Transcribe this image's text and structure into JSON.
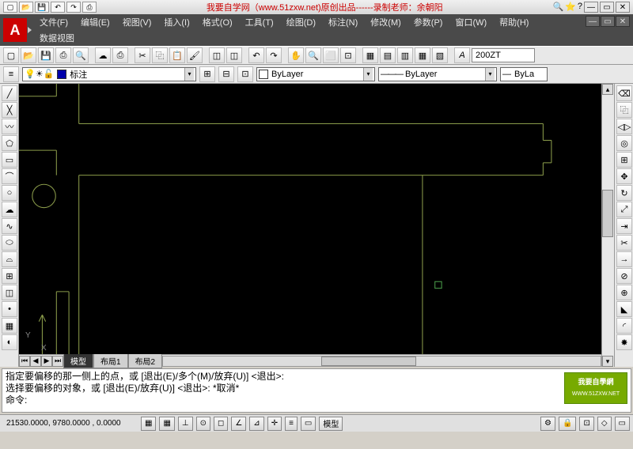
{
  "title_banner": "我要自学网（www.51zxw.net)原创出品------录制老师：余朝阳",
  "logo": "A",
  "menu": [
    "文件(F)",
    "编辑(E)",
    "视图(V)",
    "插入(I)",
    "格式(O)",
    "工具(T)",
    "绘图(D)",
    "标注(N)",
    "修改(M)",
    "参数(P)",
    "窗口(W)",
    "帮助(H)",
    "数据视图"
  ],
  "style_input": "200ZT",
  "layer": {
    "name": "标注"
  },
  "linetype": "ByLayer",
  "lineweight": "ByLayer",
  "plot": "ByLa",
  "tabs": {
    "model": "模型",
    "layout1": "布局1",
    "layout2": "布局2"
  },
  "ucs": {
    "x": "X",
    "y": "Y"
  },
  "cmd": {
    "l1": "指定要偏移的那一侧上的点，或 [退出(E)/多个(M)/放弃(U)] <退出>:",
    "l2": "选择要偏移的对象，或 [退出(E)/放弃(U)] <退出>:  *取消*",
    "l3": "命令:"
  },
  "status": {
    "coord": "21530.0000, 9780.0000 , 0.0000",
    "model": "模型",
    "brand": "我要自學網",
    "brand_url": "WWW.51ZXW.NET"
  }
}
